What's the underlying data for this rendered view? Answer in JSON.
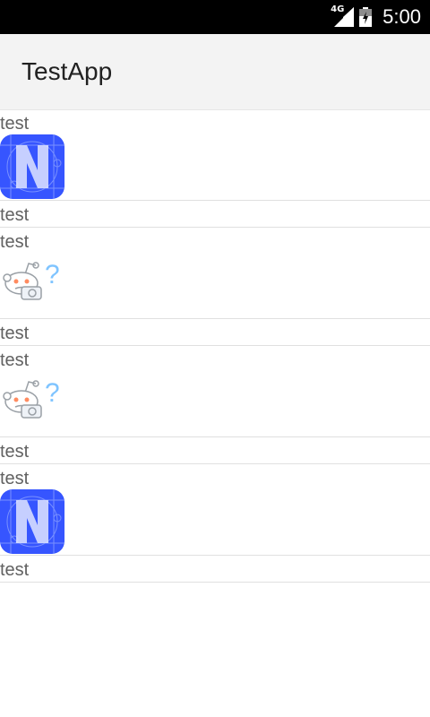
{
  "status_bar": {
    "network_label": "4G",
    "time": "5:00",
    "icons": [
      "signal-icon",
      "battery-icon"
    ]
  },
  "app_bar": {
    "title": "TestApp"
  },
  "list": {
    "items": [
      {
        "top_text": "test",
        "bottom_text": "test",
        "image": "nativescript-logo-icon"
      },
      {
        "top_text": "test",
        "bottom_text": "test",
        "image": "reddit-alien-question-icon"
      },
      {
        "top_text": "test",
        "bottom_text": "test",
        "image": "reddit-alien-question-icon"
      },
      {
        "top_text": "test",
        "bottom_text": "test",
        "image": "nativescript-logo-icon"
      }
    ]
  },
  "colors": {
    "status_bar_bg": "#000000",
    "app_bar_bg": "#f3f3f3",
    "ns_logo_blue": "#3655ff",
    "divider": "#e0e0e0",
    "text": "#616161"
  }
}
